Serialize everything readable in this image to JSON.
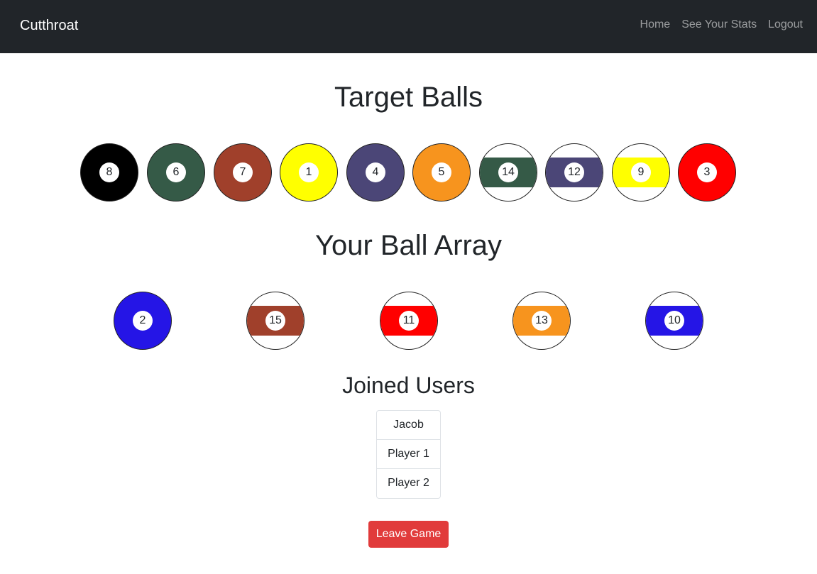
{
  "navbar": {
    "brand": "Cutthroat",
    "links": [
      "Home",
      "See Your Stats",
      "Logout"
    ]
  },
  "target_section": {
    "title": "Target Balls",
    "balls": [
      {
        "number": "8",
        "color": "#000000",
        "striped": false
      },
      {
        "number": "6",
        "color": "#355a47",
        "striped": false
      },
      {
        "number": "7",
        "color": "#a0402b",
        "striped": false
      },
      {
        "number": "1",
        "color": "#ffff00",
        "striped": false
      },
      {
        "number": "4",
        "color": "#4b4677",
        "striped": false
      },
      {
        "number": "5",
        "color": "#f7941e",
        "striped": false
      },
      {
        "number": "14",
        "color": "#355a47",
        "striped": true
      },
      {
        "number": "12",
        "color": "#4b4677",
        "striped": true
      },
      {
        "number": "9",
        "color": "#ffff00",
        "striped": true
      },
      {
        "number": "3",
        "color": "#ff0000",
        "striped": false
      }
    ]
  },
  "array_section": {
    "title": "Your Ball Array",
    "balls": [
      {
        "number": "2",
        "color": "#2515e6",
        "striped": false
      },
      {
        "number": "15",
        "color": "#a0402b",
        "striped": true
      },
      {
        "number": "11",
        "color": "#ff0000",
        "striped": true
      },
      {
        "number": "13",
        "color": "#f7941e",
        "striped": true
      },
      {
        "number": "10",
        "color": "#2515e6",
        "striped": true
      }
    ]
  },
  "users_section": {
    "title": "Joined Users",
    "users": [
      "Jacob",
      "Player 1",
      "Player 2"
    ]
  },
  "leave_button": "Leave Game"
}
